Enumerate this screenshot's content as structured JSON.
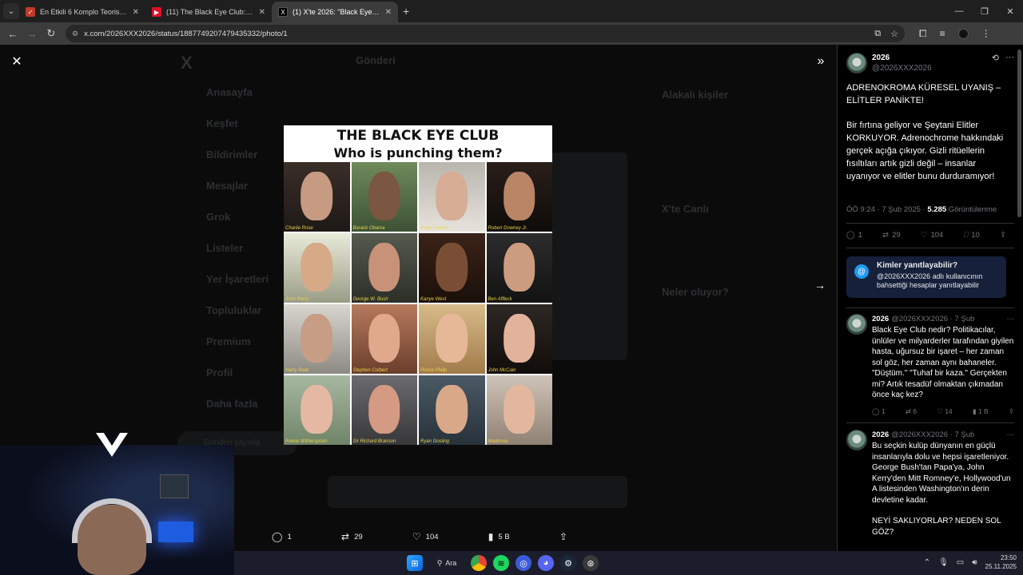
{
  "browser": {
    "tabs": [
      {
        "title": "En Etkili 6 Komplo Teorisi | Doğ",
        "active": false,
        "favicon_color": "#c0392b"
      },
      {
        "title": "(11) The Black Eye Club: The Sy",
        "active": false,
        "favicon_color": "#e0102a"
      },
      {
        "title": "(1) X'te 2026: \"Black Eye Club n",
        "active": true,
        "favicon_color": "#000000"
      }
    ],
    "new_tab": "+",
    "url": "x.com/2026XXX2026/status/1887749207479435332/photo/1"
  },
  "background_page": {
    "nav": [
      "Anasayfa",
      "Keşfet",
      "Bildirimler",
      "Mesajlar",
      "Grok",
      "Listeler",
      "Yer İşaretleri",
      "Topluluklar",
      "Premium",
      "Profil",
      "Daha fazla"
    ],
    "post_button": "Gönderi yayınla",
    "header": "Gönderi",
    "relevant": "Alakalı kişiler",
    "live": "X'te Canlı",
    "happening": "Neler oluyor?"
  },
  "photo": {
    "title_line1": "THE BLACK EYE CLUB",
    "title_line2": "Who is punching them?",
    "captions": [
      "Charlie Rose",
      "Barack Obama",
      "Pope Francis",
      "Robert Downey Jr.",
      "John Kerry",
      "George W. Bush",
      "Kanye West",
      "Ben Affleck",
      "Harry Reid",
      "Stephen Colbert",
      "Prince Philip",
      "John McCain",
      "Reese Witherspoon",
      "Sir Richard Branson",
      "Ryan Gosling",
      "Madonna"
    ]
  },
  "photo_actions": {
    "replies": "1",
    "reposts": "29",
    "likes": "104",
    "views": "5 B"
  },
  "tweet": {
    "name": "2026",
    "handle": "@2026XXX2026",
    "paragraph1": "ADRENOKROMA KÜRESEL UYANIŞ – ELİTLER PANİKTE!",
    "paragraph2": "Bir fırtına geliyor ve Şeytani Elitler KORKUYOR. Adrenochrome hakkındaki gerçek açığa çıkıyor. Gizli ritüellerin fısıltıları artık gizli değil – insanlar uyanıyor ve elitler bunu durduramıyor!",
    "time": "ÖÖ 9:24 · 7 Şub 2025 · ",
    "views_count": "5.285",
    "views_label": "Görüntülenme",
    "stats": {
      "replies": "1",
      "reposts": "29",
      "likes": "104",
      "bookmarks": "10"
    }
  },
  "reply_permission": {
    "title": "Kimler yanıtlayabilir?",
    "text": "@2026XXX2026 adlı kullanıcının bahsettiği hesaplar yanıtlayabilir"
  },
  "replies": [
    {
      "name": "2026",
      "handle": "@2026XXX2026 · 7 Şub",
      "text": "Black Eye Club nedir? Politikacılar, ünlüler ve milyarderler tarafından giyilen hasta, uğursuz bir işaret – her zaman sol göz, her zaman aynı bahaneler. \"Düştüm.\" \"Tuhaf bir kaza.\" Gerçekten mi? Artık tesadüf olmaktan çıkmadan önce kaç kez?",
      "stats": {
        "replies": "1",
        "reposts": "6",
        "likes": "14",
        "views": "1 B"
      }
    },
    {
      "name": "2026",
      "handle": "@2026XXX2026 · 7 Şub",
      "text": "Bu seçkin kulüp dünyanın en güçlü insanlarıyla dolu ve hepsi işaretleniyor. George Bush'tan Papa'ya, John Kerry'den Mitt Romney'e, Hollywood'un A listesinden Washington'ın derin devletine kadar.",
      "text2": "NEYİ SAKLIYORLAR? NEDEN SOL GÖZ?"
    }
  ],
  "taskbar": {
    "search": "Ara",
    "time": "23:50",
    "date": "25.11.2025"
  }
}
